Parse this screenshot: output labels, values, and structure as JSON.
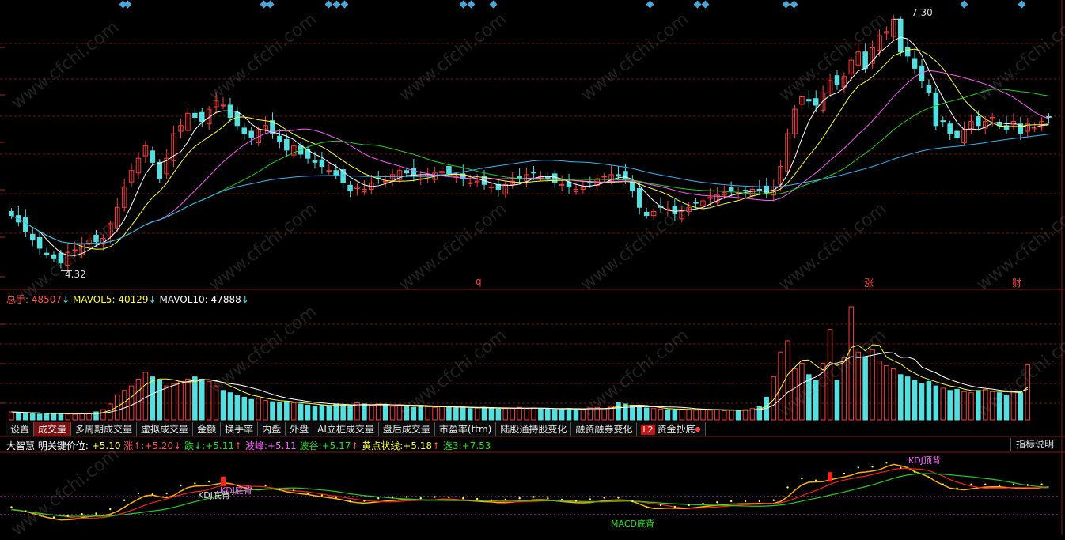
{
  "chart_data": {
    "type": "candlestick",
    "price_range": [
      4.2,
      7.4
    ],
    "max_label": "7.30",
    "min_label": "4.32",
    "markers": [
      "q",
      "涨",
      "财"
    ],
    "volume_header": {
      "total_label": "总手:",
      "total_value": "48507",
      "ma5_label": "MAVOL5:",
      "ma5_value": "40129",
      "ma10_label": "MAVOL10:",
      "ma10_value": "47888",
      "down_arrow": "↓"
    },
    "indicator_header": {
      "name": "大智慧 明关键价位:",
      "key": "+5.10",
      "up_label": "涨↑:",
      "up": "+5.20",
      "down_label": "跌↓:",
      "down": "+5.11",
      "peak_label": "波峰:",
      "peak": "+5.11",
      "valley_label": "波谷:",
      "valley": "+5.17",
      "gold_label": "黄点状线:",
      "gold": "+5.18",
      "pick_label": "选3:",
      "pick": "+7.53",
      "up_arrow": "↑",
      "down_arrow": "↓"
    },
    "signals": [
      "KDJ底背",
      "KDJ底背",
      "MACD底背",
      "KDJ顶背"
    ],
    "closes": [
      4.9,
      4.82,
      4.7,
      4.6,
      4.5,
      4.42,
      4.38,
      4.32,
      4.45,
      4.48,
      4.55,
      4.6,
      4.58,
      4.62,
      4.8,
      5.0,
      5.25,
      5.45,
      5.6,
      5.75,
      5.55,
      5.35,
      5.6,
      5.9,
      6.0,
      6.15,
      6.1,
      6.05,
      6.2,
      6.3,
      6.25,
      6.1,
      6.0,
      5.9,
      5.85,
      5.95,
      6.0,
      5.9,
      5.8,
      5.7,
      5.75,
      5.65,
      5.6,
      5.55,
      5.5,
      5.45,
      5.4,
      5.3,
      5.2,
      5.25,
      5.22,
      5.3,
      5.35,
      5.32,
      5.4,
      5.45,
      5.42,
      5.38,
      5.35,
      5.4,
      5.42,
      5.44,
      5.4,
      5.38,
      5.35,
      5.3,
      5.32,
      5.28,
      5.25,
      5.22,
      5.28,
      5.32,
      5.35,
      5.4,
      5.42,
      5.38,
      5.35,
      5.3,
      5.28,
      5.25,
      5.22,
      5.25,
      5.3,
      5.35,
      5.38,
      5.4,
      5.38,
      5.35,
      5.2,
      5.0,
      4.9,
      4.95,
      5.0,
      4.98,
      4.92,
      4.95,
      5.0,
      5.05,
      5.08,
      5.12,
      5.15,
      5.18,
      5.2,
      5.18,
      5.2,
      5.22,
      5.2,
      5.18,
      5.25,
      5.5,
      5.9,
      6.2,
      6.35,
      6.3,
      6.25,
      6.4,
      6.55,
      6.5,
      6.6,
      6.8,
      6.9,
      6.7,
      6.95,
      7.1,
      7.15,
      7.3,
      6.9,
      6.85,
      6.7,
      6.55,
      6.4,
      6.0,
      6.05,
      5.9,
      5.85,
      5.95,
      6.05,
      6.0,
      6.05,
      6.1,
      6.0,
      5.95,
      6.05,
      5.9,
      6.02,
      5.98,
      6.05,
      6.1
    ],
    "volumes": [
      7000,
      6500,
      6000,
      5500,
      5000,
      5200,
      6000,
      5500,
      5000,
      4800,
      5500,
      6000,
      7000,
      9000,
      14000,
      22000,
      26000,
      30000,
      36000,
      42000,
      38000,
      35000,
      30000,
      32000,
      34000,
      36000,
      38000,
      36000,
      34000,
      30000,
      26000,
      24000,
      22000,
      20000,
      18000,
      19000,
      17000,
      16000,
      15000,
      16000,
      15000,
      14000,
      13000,
      12000,
      13000,
      12000,
      14000,
      13000,
      12000,
      15000,
      14000,
      13000,
      14000,
      13000,
      12000,
      12500,
      12000,
      11000,
      12000,
      11500,
      11000,
      12000,
      11000,
      10500,
      11000,
      10000,
      10500,
      11000,
      10000,
      9500,
      10000,
      10500,
      11000,
      10000,
      10500,
      9500,
      10000,
      9000,
      9500,
      10000,
      9000,
      9500,
      10500,
      11000,
      10000,
      12000,
      15000,
      14000,
      13000,
      11000,
      10500,
      10000,
      9500,
      9000,
      9000,
      9500,
      9000,
      8500,
      9000,
      8500,
      9000,
      8000,
      8500,
      8000,
      9000,
      10000,
      12000,
      20000,
      38000,
      60000,
      70000,
      45000,
      50000,
      40000,
      35000,
      50000,
      80000,
      35000,
      55000,
      100000,
      60000,
      55000,
      62000,
      52000,
      48000,
      45000,
      40000,
      38000,
      35000,
      32000,
      34000,
      30000,
      28000,
      26000,
      27000,
      25000,
      24000,
      26000,
      27000,
      25000,
      24000,
      22000,
      25000,
      24000,
      48507
    ]
  },
  "tabs": [
    "设置",
    "成交量",
    "多周期成交量",
    "虚拟成交量",
    "金额",
    "换手率",
    "内盘",
    "外盘",
    "AI立桩成交量",
    "盘后成交量",
    "市盈率(ttm)",
    "陆股通持股变化",
    "融资融券变化",
    "L2",
    "资金抄底"
  ],
  "help_button": "指标说明",
  "watermark": "www.cfchi.com",
  "colors": {
    "up": "#ff3a3a",
    "down": "#54e0e0",
    "ma5": "#ffffff",
    "ma10": "#ffff3c",
    "ma20": "#ff5cff",
    "ma30": "#20d020",
    "ma60": "#30b8ff",
    "grid": "#7a1010"
  }
}
